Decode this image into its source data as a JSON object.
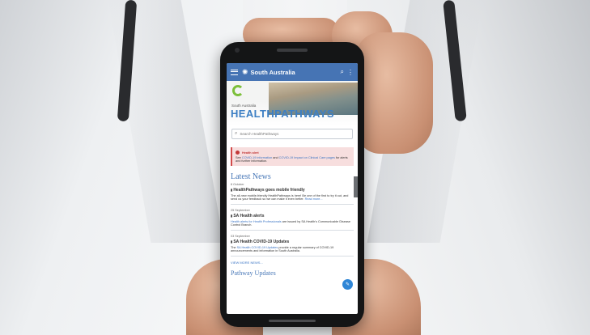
{
  "topbar": {
    "region": "South Australia",
    "menu_icon": "menu-icon",
    "search_icon": "search-icon",
    "more_icon": "more-icon"
  },
  "brand": {
    "subtitle": "South Australia",
    "name": "HEALTHPATHWAYS"
  },
  "search": {
    "placeholder": "Search HealthPathways"
  },
  "alert": {
    "title": "Health alert",
    "body_prefix": "See",
    "link1": "COVID-19 information",
    "mid": "and",
    "link2": "COVID-19 Impact on Clinical Care pages",
    "suffix": "for alerts and further information."
  },
  "news": {
    "heading": "Latest News",
    "items": [
      {
        "date": "8 October",
        "title": "HealthPathways goes mobile friendly",
        "body": "The all-new mobile-friendly HealthPathways is here! Be one of the first to try it out, and send us your feedback so we can make it even better.",
        "link": "Read more..."
      },
      {
        "date": "25 September",
        "title": "SA Health alerts",
        "link": "Health alerts for Health Professionals",
        "body": "are issued by SA Health's Communicable Disease Control Branch."
      },
      {
        "date": "03 September",
        "title": "SA Health COVID-19 Updates",
        "body_prefix": "The",
        "link": "SA Health COVID-19 Updates",
        "body": "provide a regular summary of COVID-19 announcements and information in South Australia."
      }
    ],
    "view_more": "VIEW MORE NEWS..."
  },
  "pathway_updates": {
    "heading": "Pathway Updates"
  },
  "feedback_tab": "Send Feedback",
  "colors": {
    "topbar": "#4674b4",
    "brand": "#3d7fc4",
    "alert_bg": "#f7dede",
    "accent": "#2f86d6"
  }
}
